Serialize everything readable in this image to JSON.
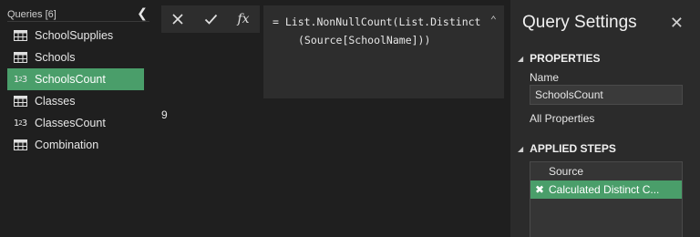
{
  "queries": {
    "header": "Queries [6]",
    "collapse_icon": "chevron-left-icon",
    "items": [
      {
        "label": "SchoolSupplies",
        "icon": "table-icon",
        "selected": false
      },
      {
        "label": "Schools",
        "icon": "table-icon",
        "selected": false
      },
      {
        "label": "SchoolsCount",
        "icon": "number-type-icon",
        "selected": true
      },
      {
        "label": "Classes",
        "icon": "table-icon",
        "selected": false
      },
      {
        "label": "ClassesCount",
        "icon": "number-type-icon",
        "selected": false
      },
      {
        "label": "Combination",
        "icon": "table-icon",
        "selected": false
      }
    ]
  },
  "formula_bar": {
    "cancel_icon": "x-icon",
    "commit_icon": "checkmark-icon",
    "fx_label": "fx",
    "line1": "= List.NonNullCount(List.Distinct",
    "line2": "(Source[SchoolName]))",
    "expand_icon": "chevron-up-icon"
  },
  "result": {
    "value": "9"
  },
  "settings": {
    "title": "Query Settings",
    "properties_heading": "PROPERTIES",
    "name_label": "Name",
    "name_value": "SchoolsCount",
    "all_properties": "All Properties",
    "applied_steps_heading": "APPLIED STEPS",
    "steps": [
      {
        "label": "Source",
        "selected": false
      },
      {
        "label": "Calculated Distinct C...",
        "selected": true
      }
    ]
  },
  "colors": {
    "selection": "#4a9e6a",
    "background": "#1f1f1f",
    "pane": "#2b2b2b"
  }
}
